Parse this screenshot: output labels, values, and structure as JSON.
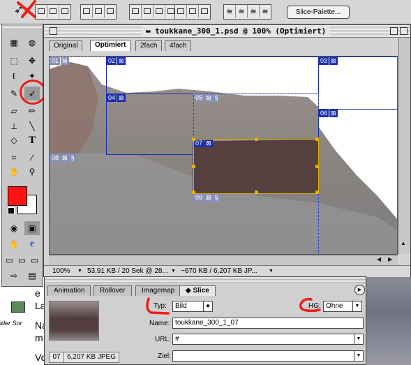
{
  "optionbar": {
    "slice_palette_label": "Slice-Palette..."
  },
  "document": {
    "title": "toukkane_300_1.psd @ 100% (Optimiert)",
    "tabs": [
      {
        "label": "Original",
        "active": false
      },
      {
        "label": "Optimiert",
        "active": true
      },
      {
        "label": "2fach",
        "active": false
      },
      {
        "label": "4fach",
        "active": false
      }
    ],
    "slices": [
      {
        "id": "01",
        "type": "dim"
      },
      {
        "id": "02",
        "type": "normal"
      },
      {
        "id": "03",
        "type": "normal"
      },
      {
        "id": "04",
        "type": "normal"
      },
      {
        "id": "05",
        "type": "dim"
      },
      {
        "id": "06",
        "type": "normal"
      },
      {
        "id": "07",
        "type": "selected"
      },
      {
        "id": "08",
        "type": "dim"
      },
      {
        "id": "09",
        "type": "dim"
      }
    ],
    "status": {
      "zoom": "100%",
      "size_time": "53,91 KB / 20 Sek @ 28...",
      "file_size": "~670 KB / 6,207 KB JP..."
    }
  },
  "palette": {
    "tabs": [
      {
        "label": "Animation",
        "active": false
      },
      {
        "label": "Rollover",
        "active": false
      },
      {
        "label": "Imagemap",
        "active": false
      },
      {
        "label": "Slice",
        "active": true
      }
    ],
    "thumbnail_number": "07",
    "thumbnail_size": "6,207 KB JPEG",
    "type_label": "Typ:",
    "type_value": "Bild",
    "hg_label": "HG:",
    "hg_value": "Ohne",
    "name_label": "Name:",
    "name_value": "toukkane_300_1_07",
    "url_label": "URL:",
    "url_value": "#",
    "ziel_label": "Ziel:",
    "ziel_value": ""
  },
  "background": {
    "text_fragments": [
      "e",
      "La",
      "Na",
      "m",
      "Vo"
    ],
    "desktop_icon_label": "lder Sor"
  },
  "colors": {
    "foreground": "#ff1414",
    "background": "#ffffff",
    "slice_border": "#1a2fb0",
    "selected_slice": "#e0b000",
    "annotation": "#ee1c1c"
  }
}
